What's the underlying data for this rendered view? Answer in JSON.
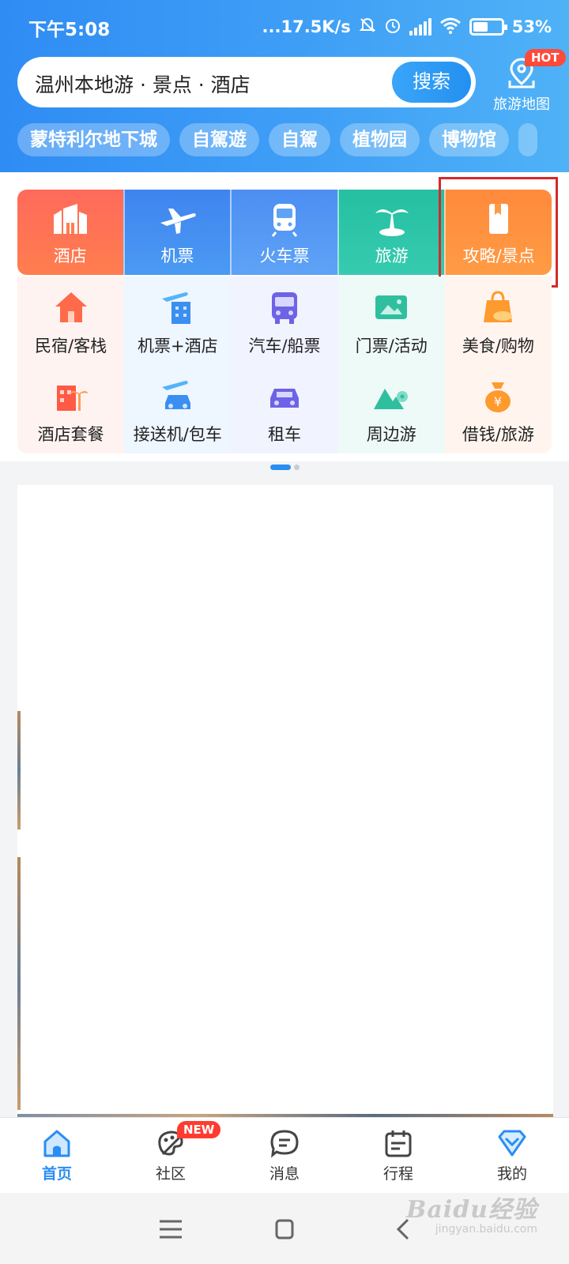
{
  "status_bar": {
    "time": "下午5:08",
    "net_speed": "...17.5K/s",
    "battery": "53%",
    "battery_level": 0.53
  },
  "search": {
    "text": "温州本地游 · 景点 · 酒店",
    "button_label": "搜索"
  },
  "map_entry": {
    "label": "旅游地图",
    "badge": "HOT"
  },
  "tags": [
    "蒙特利尔地下城",
    "自駕遊",
    "自駕",
    "植物园",
    "博物馆"
  ],
  "top_categories": [
    {
      "label": "酒店",
      "icon": "hotel-icon"
    },
    {
      "label": "机票",
      "icon": "airplane-icon"
    },
    {
      "label": "火车票",
      "icon": "train-icon"
    },
    {
      "label": "旅游",
      "icon": "palm-tree-icon"
    },
    {
      "label": "攻略/景点",
      "icon": "guidebook-icon"
    }
  ],
  "sub_categories": [
    {
      "label": "民宿/客栈",
      "icon": "house-icon"
    },
    {
      "label": "机票+酒店",
      "icon": "flight-hotel-icon"
    },
    {
      "label": "汽车/船票",
      "icon": "bus-icon"
    },
    {
      "label": "门票/活动",
      "icon": "ticket-icon"
    },
    {
      "label": "美食/购物",
      "icon": "shopping-bag-icon"
    },
    {
      "label": "酒店套餐",
      "icon": "hotel-package-icon"
    },
    {
      "label": "接送机/包车",
      "icon": "car-transfer-icon"
    },
    {
      "label": "租车",
      "icon": "car-icon"
    },
    {
      "label": "周边游",
      "icon": "mountain-pin-icon"
    },
    {
      "label": "借钱/旅游",
      "icon": "money-bag-icon"
    }
  ],
  "pager": {
    "count": 2,
    "active": 1
  },
  "tab_bar": {
    "items": [
      {
        "label": "首页",
        "icon": "home-icon"
      },
      {
        "label": "社区",
        "icon": "community-icon"
      },
      {
        "label": "消息",
        "icon": "message-icon"
      },
      {
        "label": "行程",
        "icon": "calendar-icon"
      },
      {
        "label": "我的",
        "icon": "profile-diamond-icon"
      }
    ],
    "new_badge": "NEW"
  },
  "watermark": {
    "main": "Baidu经验",
    "sub": "jingyan.baidu.com"
  },
  "colors": {
    "header_blue": "#2f8cf4",
    "accent_blue": "#2a8df2",
    "hotel_red": "#ff6a5a",
    "tour_green": "#25bfa2",
    "guide_orange": "#ff8a3b",
    "highlight_red": "#d42a2a"
  }
}
